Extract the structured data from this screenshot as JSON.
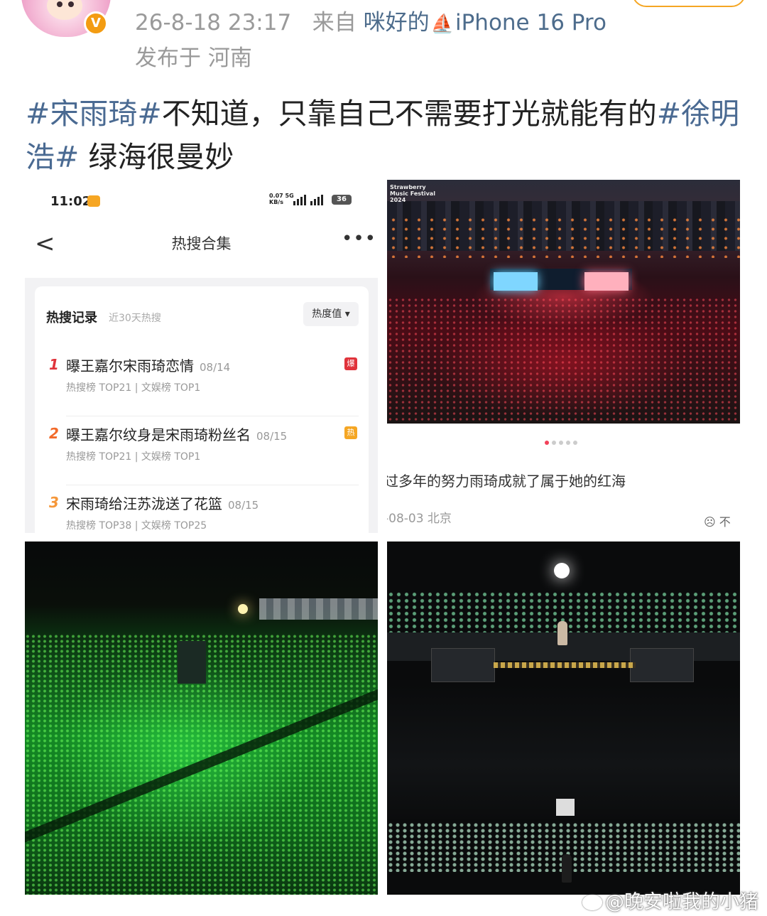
{
  "header": {
    "timestamp": "26-8-18 23:17",
    "from_prefix": "来自",
    "source_app": "咪好的",
    "device": "iPhone 16 Pro",
    "location": "发布于 河南",
    "badge": "V"
  },
  "post": {
    "tag1": "#宋雨琦#",
    "text1": "不知道，只靠自己不需要打光就能有的",
    "tag2": "#徐明浩#",
    "text2": " 绿海很曼妙"
  },
  "hot_search": {
    "status_time": "11:02",
    "status_net": "0.07 5G\nKB/s",
    "battery": "36",
    "nav_back": "<",
    "nav_title": "热搜合集",
    "nav_more": "•••",
    "card_title": "热搜记录",
    "card_subtitle": "近30天热搜",
    "sort_label": "热度值 ▾",
    "items": [
      {
        "rank": "1",
        "title": "曝王嘉尔宋雨琦恋情",
        "date": "08/14",
        "stats": "热搜榜 TOP21 | 文娱榜 TOP1",
        "badge": "爆",
        "badge_color": "#e0333b",
        "rank_color": "#e0333b"
      },
      {
        "rank": "2",
        "title": "曝王嘉尔纹身是宋雨琦粉丝名",
        "date": "08/15",
        "stats": "热搜榜 TOP21 | 文娱榜 TOP1",
        "badge": "热",
        "badge_color": "#f5a623",
        "rank_color": "#f26a2a"
      },
      {
        "rank": "3",
        "title": "宋雨琦给汪苏泷送了花篮",
        "date": "08/15",
        "stats": "热搜榜 TOP38 | 文娱榜 TOP25",
        "badge": "",
        "badge_color": "#fff",
        "rank_color": "#f5973a"
      }
    ]
  },
  "festival_post": {
    "watermark": "Strawberry\nMusic Festival\n2024",
    "caption": "过多年的努力雨琦成就了属于她的红海",
    "date": "-08-03 北京",
    "reaction": "☹ 不"
  },
  "weibo_watermark": "@晚安啦我的小猪",
  "colors": {
    "tag": "#4a6a92",
    "meta": "#9a9a9a",
    "accent": "#f39c12"
  }
}
